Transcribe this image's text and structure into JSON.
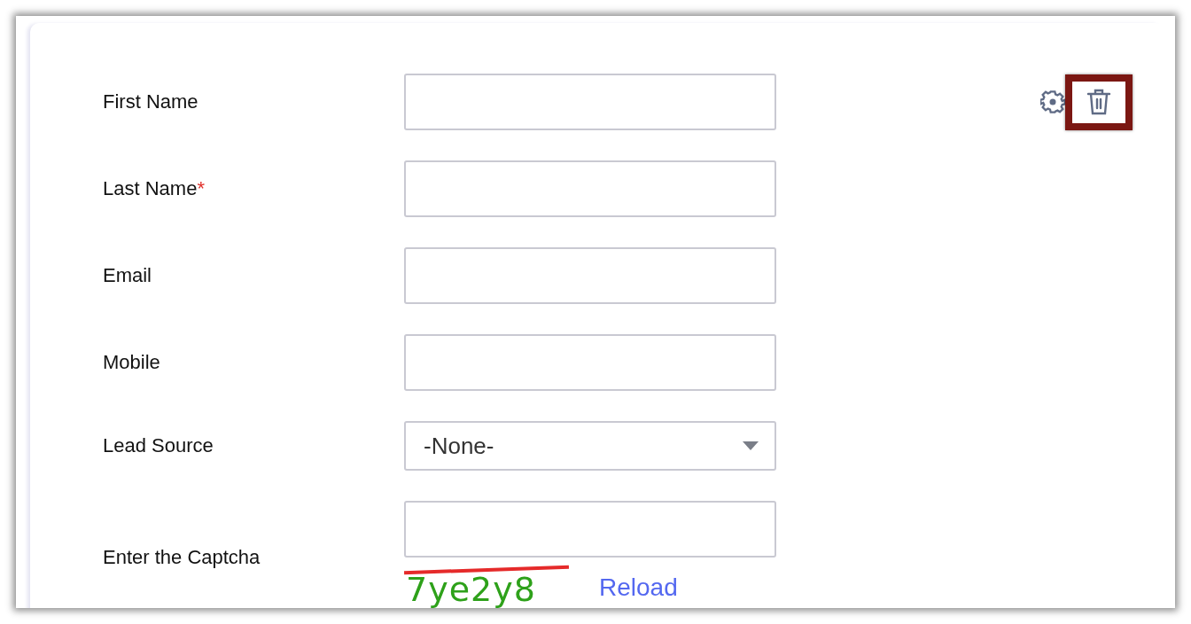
{
  "required_mark": "*",
  "fields": [
    {
      "kind": "text",
      "label": "First Name",
      "required": false
    },
    {
      "kind": "text",
      "label": "Last Name",
      "required": true
    },
    {
      "kind": "text",
      "label": "Email",
      "required": false
    },
    {
      "kind": "text",
      "label": "Mobile",
      "required": false
    },
    {
      "kind": "select",
      "label": "Lead Source",
      "required": false,
      "value": "-None-"
    },
    {
      "kind": "captcha",
      "label": "Enter the Captcha",
      "required": false,
      "captcha": "7ye2y8",
      "reload": "Reload"
    }
  ],
  "actions": [
    {
      "kind": "settings",
      "highlighted": false
    },
    {
      "kind": "delete",
      "highlighted": true
    }
  ]
}
